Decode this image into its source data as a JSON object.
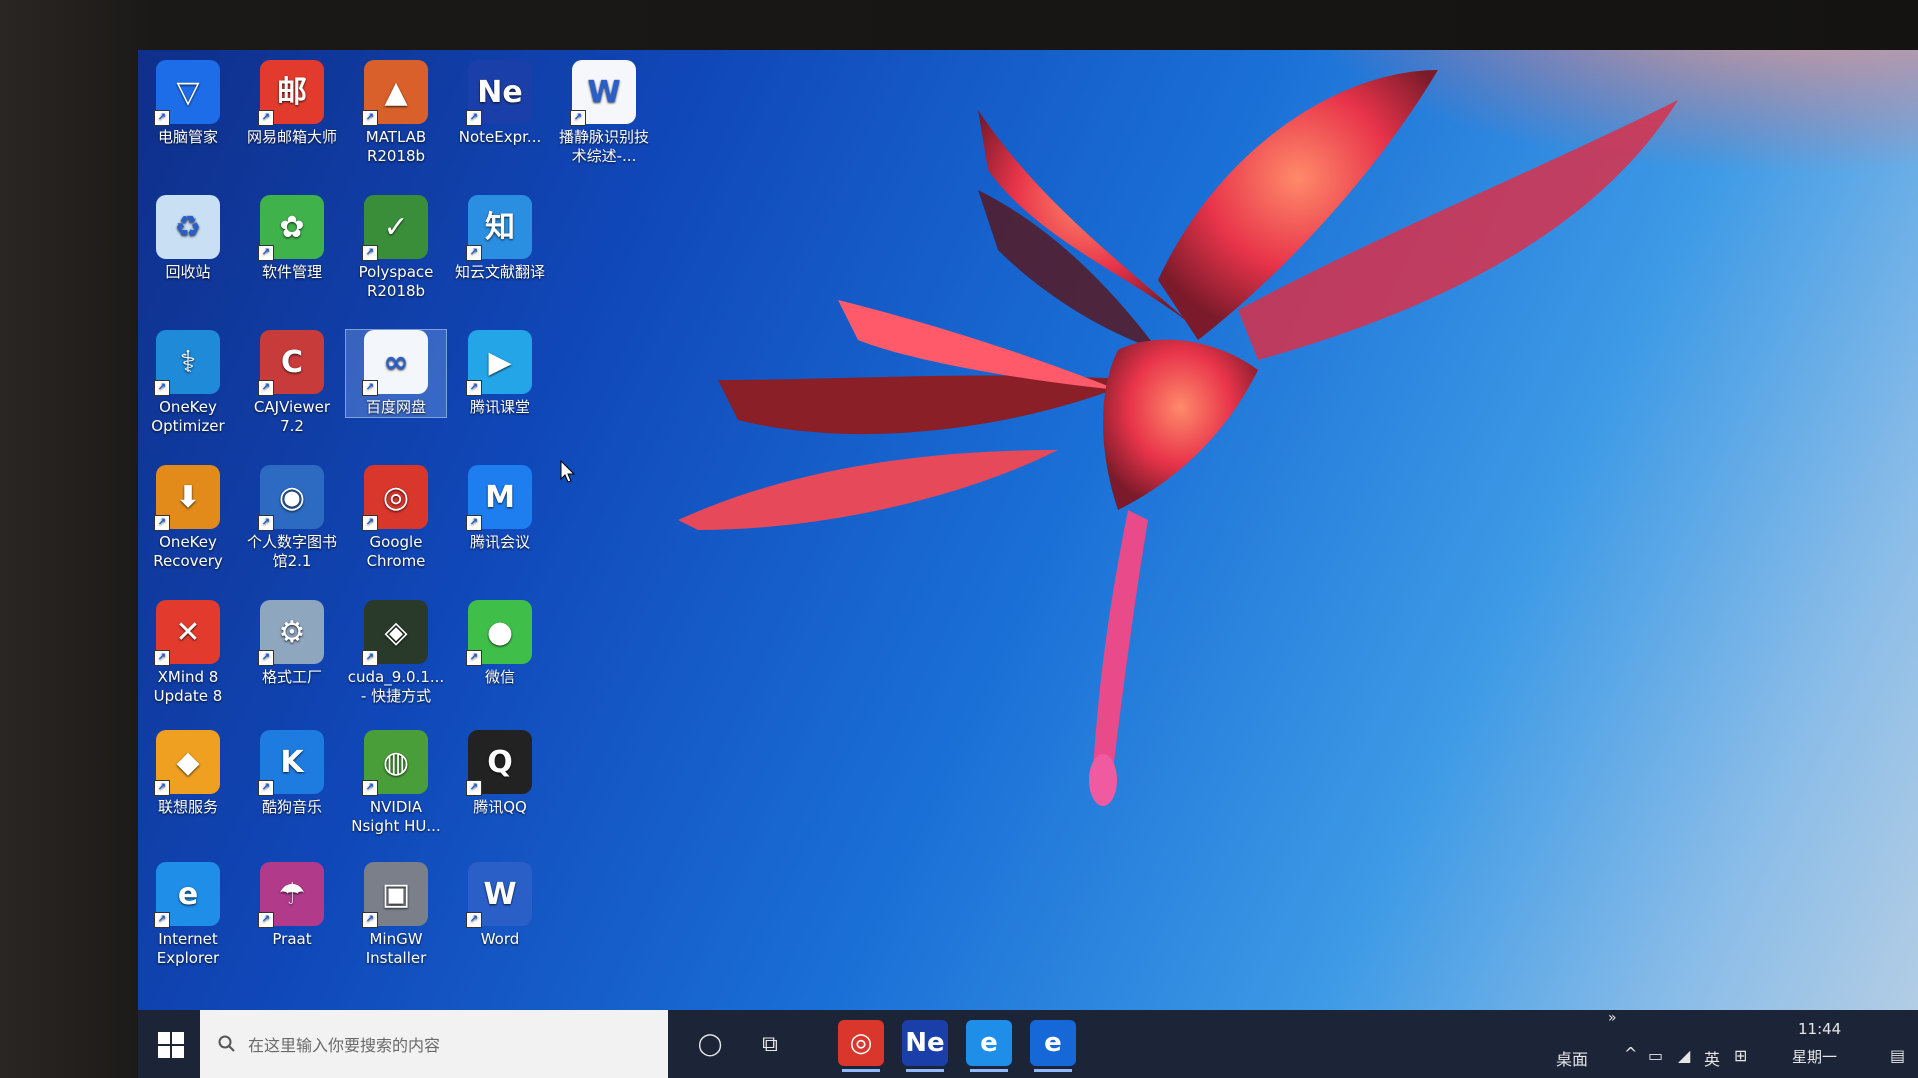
{
  "desktop": {
    "icons": [
      {
        "label": "电脑管家",
        "glyph": "▽",
        "color": "#1e6de8"
      },
      {
        "label": "网易邮箱大师",
        "glyph": "邮",
        "color": "#e23b2e"
      },
      {
        "label": "MATLAB R2018b",
        "glyph": "▲",
        "color": "#d9602a"
      },
      {
        "label": "NoteExpr...",
        "glyph": "Ne",
        "color": "#1b3fa8"
      },
      {
        "label": "播静脉识别技术综述-...",
        "glyph": "W",
        "color": "#f5f7fb"
      },
      {
        "label": "回收站",
        "glyph": "♻",
        "color": "#c9dff4"
      },
      {
        "label": "软件管理",
        "glyph": "✿",
        "color": "#3fb24c"
      },
      {
        "label": "Polyspace R2018b",
        "glyph": "✓",
        "color": "#3a8e3a"
      },
      {
        "label": "知云文献翻译",
        "glyph": "知",
        "color": "#2a8fe0"
      },
      {
        "label": "OneKey Optimizer",
        "glyph": "⚕",
        "color": "#1e8ad8"
      },
      {
        "label": "CAJViewer 7.2",
        "glyph": "C",
        "color": "#c83b3b"
      },
      {
        "label": "百度网盘",
        "glyph": "∞",
        "color": "#f3f6fb"
      },
      {
        "label": "腾讯课堂",
        "glyph": "▶",
        "color": "#23a5e8"
      },
      {
        "label": "OneKey Recovery",
        "glyph": "⬇",
        "color": "#e28a1a"
      },
      {
        "label": "个人数字图书馆2.1",
        "glyph": "◉",
        "color": "#2d6ac2"
      },
      {
        "label": "Google Chrome",
        "glyph": "◎",
        "color": "#d9362c"
      },
      {
        "label": "腾讯会议",
        "glyph": "M",
        "color": "#1e7ef0"
      },
      {
        "label": "XMind 8 Update 8",
        "glyph": "✕",
        "color": "#e23b2e"
      },
      {
        "label": "格式工厂",
        "glyph": "⚙",
        "color": "#8fa6bf"
      },
      {
        "label": "cuda_9.0.1... - 快捷方式",
        "glyph": "◈",
        "color": "#2a3a2a"
      },
      {
        "label": "微信",
        "glyph": "●",
        "color": "#3fbf4a"
      },
      {
        "label": "联想服务",
        "glyph": "◆",
        "color": "#f0a020"
      },
      {
        "label": "酷狗音乐",
        "glyph": "K",
        "color": "#1e7be0"
      },
      {
        "label": "NVIDIA Nsight HU...",
        "glyph": "◍",
        "color": "#4a9e3a"
      },
      {
        "label": "腾讯QQ",
        "glyph": "Q",
        "color": "#222222"
      },
      {
        "label": "Internet Explorer",
        "glyph": "e",
        "color": "#1e8ee8"
      },
      {
        "label": "Praat",
        "glyph": "☂",
        "color": "#b23a8a"
      },
      {
        "label": "MinGW Installer",
        "glyph": "▣",
        "color": "#7a7f8a"
      },
      {
        "label": "Word",
        "glyph": "W",
        "color": "#2a5fc8"
      }
    ]
  },
  "taskbar": {
    "search_placeholder": "在这里输入你要搜索的内容",
    "pinned": [
      {
        "name": "chrome",
        "glyph": "◎",
        "color": "#d9362c"
      },
      {
        "name": "noteexpress",
        "glyph": "Ne",
        "color": "#1b3fa8"
      },
      {
        "name": "internet-explorer",
        "glyph": "e",
        "color": "#1e8ee8"
      },
      {
        "name": "edge",
        "glyph": "e",
        "color": "#1668d8"
      }
    ],
    "desktop_label": "桌面",
    "ime_label": "英",
    "time": "11:44",
    "weekday": "星期一",
    "overflow": "»"
  }
}
